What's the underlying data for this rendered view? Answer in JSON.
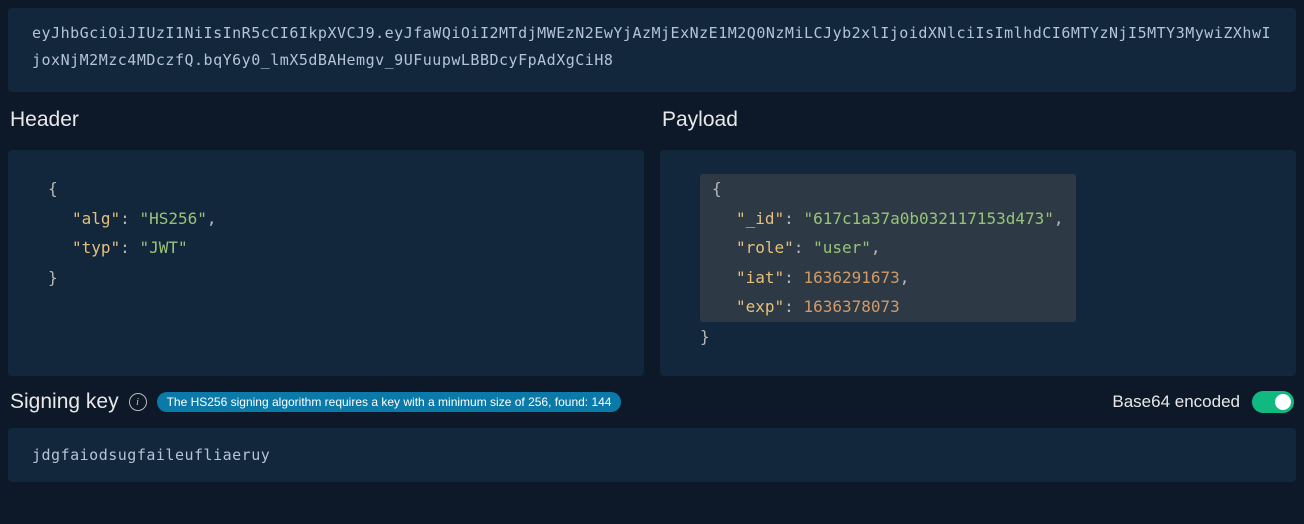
{
  "token": "eyJhbGciOiJIUzI1NiIsInR5cCI6IkpXVCJ9.eyJfaWQiOiI2MTdjMWEzN2EwYjAzMjExNzE1M2Q0NzMiLCJyb2xlIjoidXNlciIsImlhdCI6MTYzNjI5MTY3MywiZXhwIjoxNjM2Mzc4MDczfQ.bqY6y0_lmX5dBAHemgv_9UFuupwLBBDcyFpAdXgCiH8",
  "sections": {
    "header_title": "Header",
    "payload_title": "Payload"
  },
  "header": {
    "alg_key": "\"alg\"",
    "alg_val": "\"HS256\"",
    "typ_key": "\"typ\"",
    "typ_val": "\"JWT\""
  },
  "payload": {
    "id_key": "\"_id\"",
    "id_val": "\"617c1a37a0b032117153d473\"",
    "role_key": "\"role\"",
    "role_val": "\"user\"",
    "iat_key": "\"iat\"",
    "iat_val": "1636291673",
    "exp_key": "\"exp\"",
    "exp_val": "1636378073"
  },
  "signing": {
    "title": "Signing key",
    "warning": "The HS256 signing algorithm requires a key with a minimum size of 256, found: 144",
    "toggle_label": "Base64 encoded",
    "key_value": "jdgfaiodsugfaileufliaeruy"
  }
}
